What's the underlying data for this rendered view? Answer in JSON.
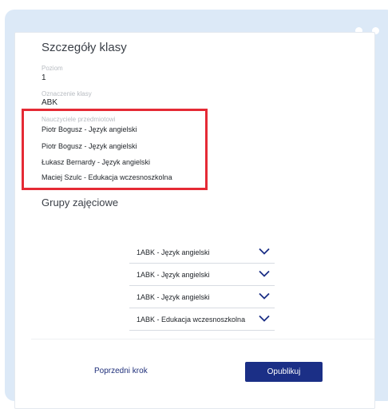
{
  "card": {
    "title": "Szczegóły klasy",
    "level_label": "Poziom",
    "level_value": "1",
    "designation_label": "Oznaczenie klasy",
    "designation_value": "ABK",
    "teachers_label": "Nauczyciele przedmiotowi",
    "teachers": [
      "Piotr Bogusz - Język angielski",
      "Piotr Bogusz - Język angielski",
      "Łukasz Bernardy - Język angielski",
      "Maciej Szulc - Edukacja wczesnoszkolna"
    ],
    "groups_title": "Grupy zajęciowe",
    "groups": [
      "1ABK - Język angielski",
      "1ABK - Język angielski",
      "1ABK - Język angielski",
      "1ABK - Edukacja wczesnoszkolna"
    ]
  },
  "footer": {
    "prev_label": "Poprzedni krok",
    "publish_label": "Opublikuj"
  },
  "colors": {
    "highlight": "#e52a35",
    "primary": "#1b2f86",
    "frame": "#dce9f7"
  },
  "icons": {
    "group_expand": "chevron-down-icon"
  }
}
